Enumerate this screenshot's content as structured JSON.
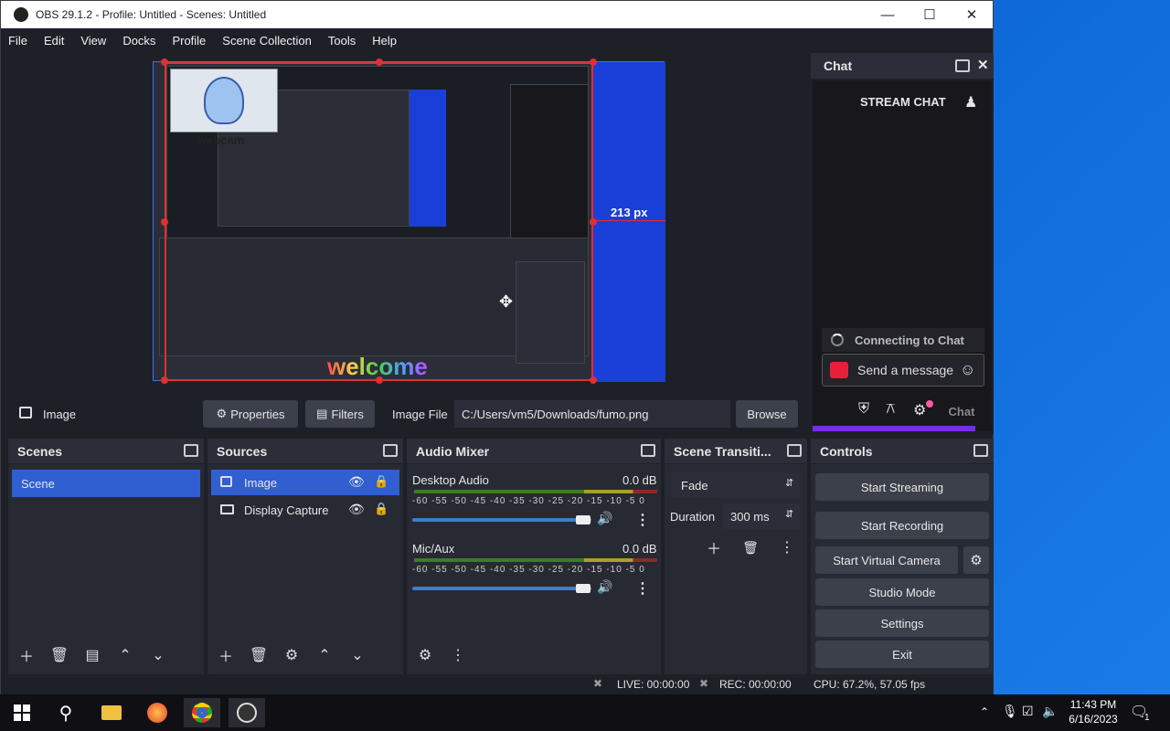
{
  "window": {
    "title": "OBS 29.1.2 - Profile: Untitled - Scenes: Untitled"
  },
  "menu": [
    "File",
    "Edit",
    "View",
    "Docks",
    "Profile",
    "Scene Collection",
    "Tools",
    "Help"
  ],
  "preview": {
    "dimension_label": "213 px",
    "webcam_label": "webcam",
    "welcome_text": "welcome"
  },
  "chat": {
    "dock_title": "Chat",
    "stream_chat_title": "STREAM CHAT",
    "connecting_text": "Connecting to Chat",
    "send_placeholder": "Send a message",
    "chat_button": "Chat"
  },
  "source_bar": {
    "source_name": "Image",
    "properties_label": "Properties",
    "filters_label": "Filters",
    "image_file_label": "Image File",
    "image_file_path": "C:/Users/vm5/Downloads/fumo.png",
    "browse_label": "Browse"
  },
  "scenes": {
    "title": "Scenes",
    "items": [
      "Scene"
    ]
  },
  "sources": {
    "title": "Sources",
    "items": [
      "Image",
      "Display Capture"
    ]
  },
  "audio": {
    "title": "Audio Mixer",
    "channels": [
      {
        "name": "Desktop Audio",
        "level": "0.0 dB",
        "volume": 0.95
      },
      {
        "name": "Mic/Aux",
        "level": "0.0 dB",
        "volume": 0.95
      }
    ],
    "scale": [
      "-60",
      "-55",
      "-50",
      "-45",
      "-40",
      "-35",
      "-30",
      "-25",
      "-20",
      "-15",
      "-10",
      "-5",
      "0"
    ]
  },
  "transitions": {
    "title": "Scene Transiti...",
    "selected": "Fade",
    "duration_label": "Duration",
    "duration_value": "300 ms"
  },
  "controls": {
    "title": "Controls",
    "start_streaming": "Start Streaming",
    "start_recording": "Start Recording",
    "start_virtual_camera": "Start Virtual Camera",
    "studio_mode": "Studio Mode",
    "settings": "Settings",
    "exit": "Exit"
  },
  "status": {
    "live": "LIVE: 00:00:00",
    "rec": "REC: 00:00:00",
    "cpu": "CPU: 67.2%, 57.05 fps"
  },
  "taskbar": {
    "time": "11:43 PM",
    "date": "6/16/2023",
    "notification_count": "1"
  },
  "colors": {
    "accent": "#2f5fd0",
    "selection_red": "#e03030",
    "twitch_purple": "#772ce8"
  }
}
